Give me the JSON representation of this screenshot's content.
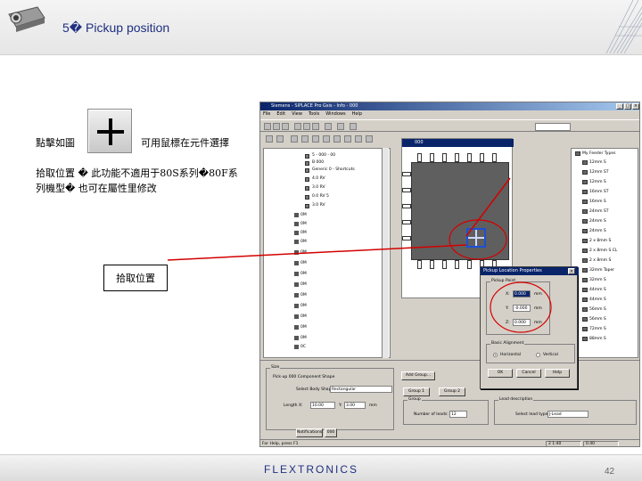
{
  "header": {
    "title": "5� Pickup position"
  },
  "body": {
    "click_label": "點擊如圖",
    "mouse_label": "可用鼠標在元件選擇",
    "note_line1": "拾取位置 � 此功能不適用于80S系列�80F系",
    "note_line2": "列機型� 也可在屬性里修改",
    "pickup_label": "拾取位置"
  },
  "app": {
    "title": "Siemens - SIPLACE Pro Gsis - Info - 000",
    "menu": [
      "File",
      "Edit",
      "View",
      "Tools",
      "Windows",
      "Help"
    ],
    "tree_items": [
      {
        "label": "5 - 000 - 00"
      },
      {
        "label": "B 000"
      },
      {
        "label": "Generic 0 - Shortcuts"
      },
      {
        "label": "4.0 RV"
      },
      {
        "label": "3.0 RV"
      },
      {
        "label": "0.0 RV 5"
      },
      {
        "label": "3.0 RV"
      }
    ],
    "side_items": [
      "0M",
      "0M",
      "0M",
      "0M",
      "0M",
      "0M",
      "0M",
      "0M",
      "0M",
      "0M",
      "0M",
      "0M",
      "0M",
      "0C",
      "0M",
      "0M"
    ],
    "component_window": {
      "title": "000"
    },
    "right_panel": {
      "title": "My Feeder Types",
      "items": [
        "12mm S",
        "12mm ST",
        "12mm S",
        "16mm ST",
        "16mm S",
        "24mm ST",
        "24mm S",
        "24mm S",
        "2 x 8mm S",
        "2 x 8mm S CL",
        "2 x 8mm S",
        "32mm Taper",
        "32mm S",
        "44mm S",
        "44mm S",
        "56mm S",
        "56mm S",
        "72mm S",
        "88mm S"
      ]
    },
    "dialog": {
      "title": "Pickup Location Properties",
      "group_pickup": "Pickup Point",
      "x_label": "X:",
      "x_value": "0.000",
      "y_label": "Y:",
      "y_value": "-0.000",
      "z_label": "Z:",
      "z_value": "0.000",
      "unit": "mm",
      "group_align": "Basic Alignment",
      "align_h": "Horizontal",
      "align_v": "Vertical",
      "ok": "OK",
      "cancel": "Cancel",
      "help": "Help"
    },
    "bottom": {
      "size_label": "Size",
      "checkbox_label": "Pick-up 000 Component Shape",
      "shape_label": "Select Body Shape:",
      "shape_value": "Rectangular",
      "length_label": "Length X:",
      "length_value": "10.00",
      "width_label": "Y:",
      "width_value": "3.00",
      "unit": "mm",
      "add_group": "Add Group...",
      "group1": "Group 1",
      "group2": "Group 2",
      "group_label": "Group",
      "number_label": "Number of leads:",
      "number_value": "12",
      "lead_label": "Lead description",
      "lead_type_label": "Select lead type:",
      "lead_type_value": "J-Lead",
      "tab1": "Notifications",
      "tab2": "000"
    },
    "status": {
      "left": "For Help, press F1",
      "mid": "2 1:40",
      "right": "0.40"
    }
  },
  "footer": {
    "brand": "FLEXTRONICS",
    "page": "42"
  },
  "colors": {
    "title_blue": "#1f2f80",
    "red_line": "#d40000",
    "pick_blue": "#1b4fd6"
  }
}
